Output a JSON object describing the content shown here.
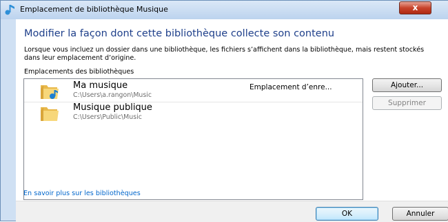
{
  "window": {
    "title": "Emplacement de bibliothèque Musique",
    "close_label": "x"
  },
  "main": {
    "heading": "Modifier la façon dont cette bibliothèque collecte son contenu",
    "description": "Lorsque vous incluez un dossier dans une bibliothèque, les fichiers s’affichent dans la bibliothèque, mais restent stockés dans leur emplacement d’origine.",
    "locations_label": "Emplacements des bibliothèques",
    "locations": [
      {
        "name": "Ma musique",
        "path": "C:\\Users\\a.rangon\\Music",
        "status": "Emplacement d’enre...",
        "icon": "music-folder-icon"
      },
      {
        "name": "Musique publique",
        "path": "C:\\Users\\Public\\Music",
        "status": "",
        "icon": "folder-icon"
      }
    ],
    "add_button": "Ajouter...",
    "remove_button": "Supprimer",
    "help_link": "En savoir plus sur les bibliothèques"
  },
  "footer": {
    "ok_button": "OK",
    "cancel_button": "Annuler"
  },
  "colors": {
    "heading": "#1e3f8a",
    "link": "#0066cc",
    "frame": "#cfe0f3",
    "close_button": "#c8442c"
  }
}
